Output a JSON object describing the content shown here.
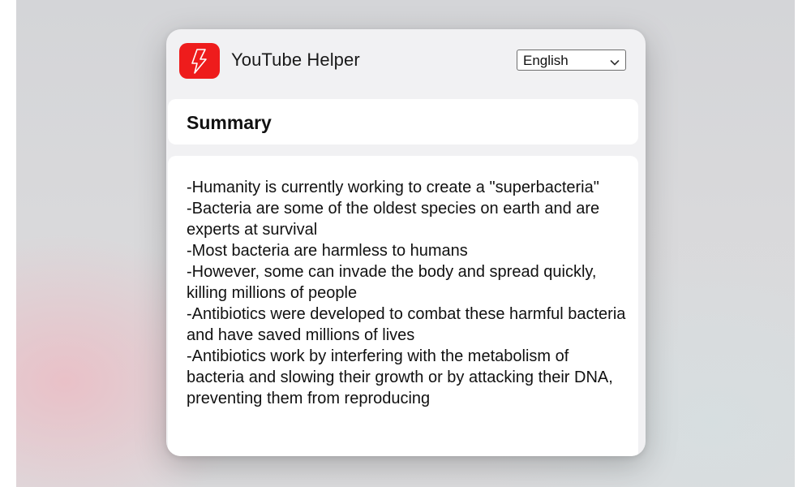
{
  "app": {
    "title": "YouTube Helper",
    "logo_icon": "lightning-bolt-icon",
    "brand_color": "#ee1c1c"
  },
  "language": {
    "selected": "English",
    "icon": "chevron-down-icon"
  },
  "summary": {
    "heading": "Summary",
    "points": [
      "-Humanity is currently working to create a \"superbacteria\"",
      "-Bacteria are some of the oldest species on earth and are experts at survival",
      "-Most bacteria are harmless to humans",
      "-However, some can invade the body and spread quickly, killing millions of people",
      "-Antibiotics were developed to combat these harmful bacteria and have saved millions of lives",
      "-Antibiotics work by interfering with the metabolism of bacteria and slowing their growth or by attacking their DNA, preventing them from reproducing"
    ]
  }
}
